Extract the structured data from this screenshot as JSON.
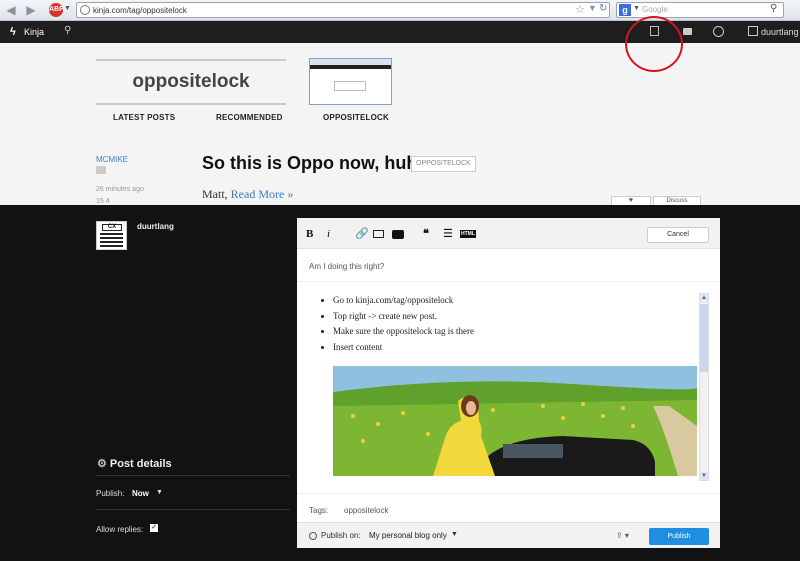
{
  "browser": {
    "url": "kinja.com/tag/oppositelock",
    "search_placeholder": "Google"
  },
  "kinja_bar": {
    "brand": "Kinja",
    "username": "duurtlang"
  },
  "blog": {
    "title": "oppositelock",
    "tabs": [
      "LATEST POSTS",
      "RECOMMENDED",
      "OPPOSITELOCK"
    ],
    "post": {
      "author": "MCMIKE",
      "time": "26 minutes ago",
      "stats": "15   4",
      "title": "So this is Oppo now, huh?",
      "tag": "OPPOSITELOCK",
      "body_prefix": "Matt,",
      "read_more": "Read More »",
      "like_label": "♥",
      "discuss_label": "Discuss"
    }
  },
  "overlay": {
    "username": "duurtlang",
    "avatar_text": "CX",
    "post_details": {
      "title": "Post details",
      "publish_label": "Publish:",
      "publish_value": "Now",
      "allow_replies_label": "Allow replies:",
      "allow_replies_checked": true
    }
  },
  "editor": {
    "toolbar": {
      "bold": "B",
      "italic": "i",
      "quote": "❝",
      "html": "HTML",
      "cancel": "Cancel"
    },
    "headline": "Am I doing this right?",
    "list_items": [
      "Go to kinja.com/tag/oppositelock",
      "Top right -> create new post.",
      "Make sure the oppositelock tag is there",
      "Insert content"
    ],
    "tags_label": "Tags:",
    "tags_value": "oppositelock",
    "footer": {
      "publish_on_label": "Publish on:",
      "publish_target": "My personal blog only",
      "publish_button": "Publish"
    }
  },
  "colors": {
    "accent_blue": "#1e8fe0",
    "link_blue": "#3a7cc2",
    "annotation_red": "#d2161b",
    "overlay_bg": "#121212"
  }
}
